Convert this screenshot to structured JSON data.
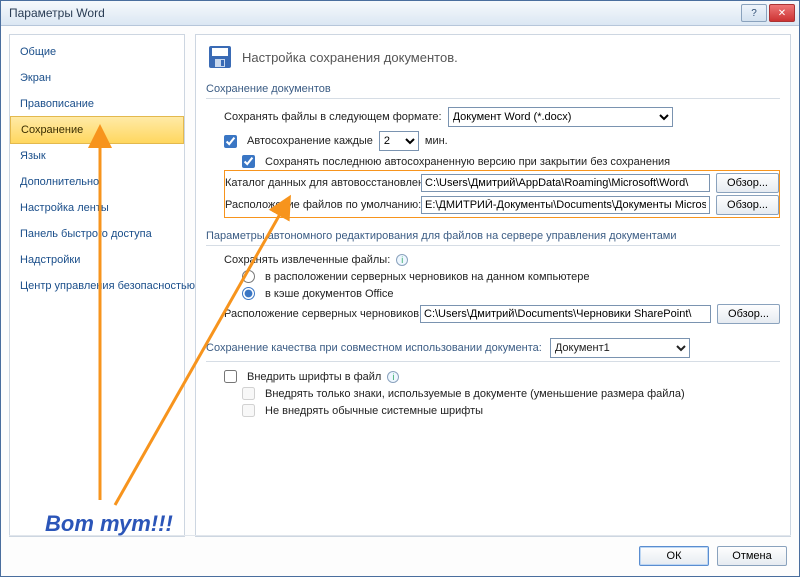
{
  "window": {
    "title": "Параметры Word"
  },
  "sidebar": {
    "items": [
      {
        "label": "Общие"
      },
      {
        "label": "Экран"
      },
      {
        "label": "Правописание"
      },
      {
        "label": "Сохранение",
        "selected": true
      },
      {
        "label": "Язык"
      },
      {
        "label": "Дополнительно"
      },
      {
        "label": "Настройка ленты"
      },
      {
        "label": "Панель быстрого доступа"
      },
      {
        "label": "Надстройки"
      },
      {
        "label": "Центр управления безопасностью"
      }
    ]
  },
  "headline": "Настройка сохранения документов.",
  "sections": {
    "save_docs": {
      "title": "Сохранение документов",
      "format_label": "Сохранять файлы в следующем формате:",
      "format_value": "Документ Word (*.docx)",
      "autosave_label": "Автосохранение каждые",
      "autosave_value": "2",
      "autosave_unit": "мин.",
      "keep_last_label": "Сохранять последнюю автосохраненную версию при закрытии без сохранения",
      "autorecover_label": "Каталог данных для автовосстановления:",
      "autorecover_path": "C:\\Users\\Дмитрий\\AppData\\Roaming\\Microsoft\\Word\\",
      "default_loc_label": "Расположение файлов по умолчанию:",
      "default_loc_path": "E:\\ДМИТРИЙ-Документы\\Documents\\Документы Microsoft Word",
      "browse": "Обзор..."
    },
    "offline": {
      "title": "Параметры автономного редактирования для файлов на сервере управления документами",
      "save_checkedout": "Сохранять извлеченные файлы:",
      "opt_server_drafts": "в расположении серверных черновиков на данном компьютере",
      "opt_office_cache": "в кэше документов Office",
      "drafts_loc_label": "Расположение серверных черновиков:",
      "drafts_path": "C:\\Users\\Дмитрий\\Documents\\Черновики SharePoint\\",
      "browse": "Обзор..."
    },
    "fidelity": {
      "title": "Сохранение качества при совместном использовании документа:",
      "doc_name": "Документ1",
      "embed_fonts": "Внедрить шрифты в файл",
      "embed_only_used": "Внедрять только знаки, используемые в документе (уменьшение размера файла)",
      "no_system_fonts": "Не внедрять обычные системные шрифты"
    }
  },
  "footer": {
    "ok": "ОК",
    "cancel": "Отмена"
  },
  "callout": "Вот тут!!!"
}
